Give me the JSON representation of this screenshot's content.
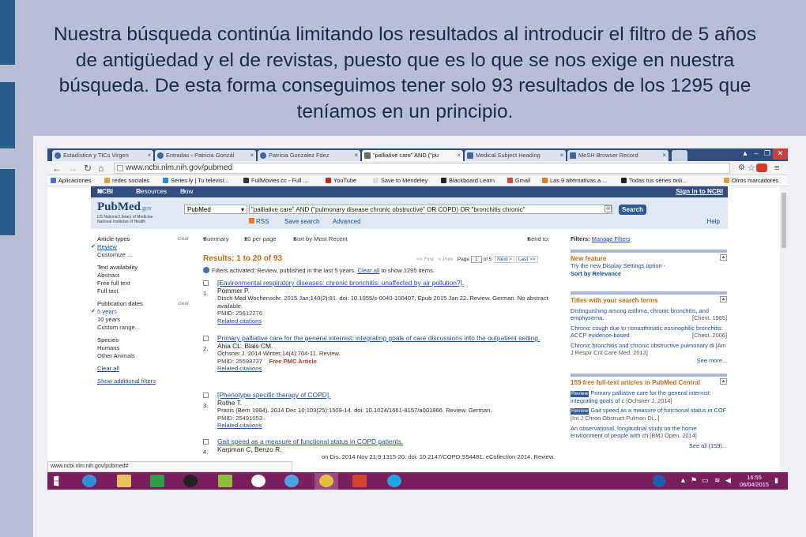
{
  "slide": {
    "caption": "Nuestra búsqueda continúa limitando los resultados al introducir el filtro de 5 años de antigüedad y el de revistas, puesto que es lo que se nos exige en nuestra búsqueda. De esta forma conseguimos tener solo 93 resultados de los 1295 que teníamos en un principio."
  },
  "browser": {
    "tabs": [
      {
        "label": "Estadística y TICs Virgen"
      },
      {
        "label": "Entradas ‹ Patricia Gonzál"
      },
      {
        "label": "Patricia Gonzalez Fdez"
      },
      {
        "label": "\"palliative care\" AND (\"pu"
      },
      {
        "label": "Medical Subject Heading"
      },
      {
        "label": "MeSH Browser Record"
      }
    ],
    "url": "www.ncbi.nlm.nih.gov/pubmed",
    "bookmarks": [
      {
        "label": "Aplicaciones"
      },
      {
        "label": "redes sociales"
      },
      {
        "label": "Series.ly | Tu televisi..."
      },
      {
        "label": "FullMovies.cc - Full ..."
      },
      {
        "label": "YouTube"
      },
      {
        "label": "Save to Mendeley"
      },
      {
        "label": "Blackboard Learn"
      },
      {
        "label": "Gmail"
      },
      {
        "label": "Las 9 alternativas a ..."
      },
      {
        "label": "Todas tus series onli..."
      },
      {
        "label": "Otros marcadores"
      }
    ],
    "status_url": "www.ncbi.nlm.nih.gov/pubmed#"
  },
  "ncbi": {
    "brand": "NCBI",
    "resources": "Resources",
    "howto": "How To",
    "signin": "Sign in to NCBI"
  },
  "pubmed": {
    "logo": "PubMed",
    "logo_suffix": ".gov",
    "logo_sub1": "US National Library of Medicine",
    "logo_sub2": "National Institutes of Health",
    "db": "PubMed",
    "query": "\"palliative care\" AND (\"pulmonary disease chronic obstructive\" OR COPD) OR \"bronchitis chronic\"",
    "search_btn": "Search",
    "rss": "RSS",
    "save_search": "Save search",
    "advanced": "Advanced",
    "help": "Help"
  },
  "sidebar": {
    "clear": "clear",
    "article_types": "Article types",
    "review": "Review",
    "customize": "Customize ...",
    "text_availability": "Text availability",
    "abstract": "Abstract",
    "free_full_text": "Free full text",
    "full_text": "Full text",
    "pub_dates": "Publication dates",
    "five_years": "5 years",
    "ten_years": "10 years",
    "custom_range": "Custom range...",
    "species": "Species",
    "humans": "Humans",
    "other_animals": "Other Animals",
    "clear_all": "Clear all",
    "show_additional": "Show additional filters"
  },
  "results": {
    "summary": "Summary",
    "per_page": "20 per page",
    "sort": "Sort by Most Recent",
    "send_to": "Send to:",
    "title": "Results: 1 to 20 of 93",
    "first": "<< First",
    "prev": "< Prev",
    "page_label": "Page",
    "page": "1",
    "of": "of 5",
    "next": "Next >",
    "last": "Last >>",
    "filters_text": "Filters activated: Review, published in the last 5 years.",
    "clear_all": "Clear all",
    "filters_tail": "to show 1295 items.",
    "items": [
      {
        "num": "1.",
        "title": "[Environmental respiratory diseases: chronic bronchitis: unaffected by air pollution?].",
        "authors": "Pommer P.",
        "citation": "Dtsch Med Wochenschr. 2015 Jan;140(2):81. doi: 10.1055/s-0040-100407. Epub 2015 Jan 22. Review. German. No abstract available.",
        "pmid": "PMID: 25612276",
        "pmc": "",
        "related": "Related citations"
      },
      {
        "num": "2.",
        "title": "Primary palliative care for the general internist: integrating goals of care discussions into the outpatient setting.",
        "authors": "Ahia CL, Blais CM.",
        "citation": "Ochsner J. 2014 Winter;14(4):704-11. Review.",
        "pmid": "PMID: 25598737",
        "pmc": "Free PMC Article",
        "related": "Related citations"
      },
      {
        "num": "3.",
        "title": "[Phenotype specific therapy of COPD].",
        "authors": "Rothe T.",
        "citation": "Praxis (Bern 1994). 2014 Dec 10;103(25):1509-14. doi: 10.1024/1661-8157/a001866. Review. German.",
        "pmid": "PMID: 25491053",
        "pmc": "",
        "related": "Related citations"
      },
      {
        "num": "4.",
        "title": "Gait speed as a measure of functional status in COPD patients.",
        "authors": "Karpman C, Benzo R.",
        "citation": "on Dis. 2014 Nov 21;9:1315-20. doi: 10.2147/COPD.S54481. eCollection 2014. Review.",
        "pmid": "",
        "pmc": "",
        "related": ""
      }
    ]
  },
  "right": {
    "filters_label": "Filters:",
    "manage": "Manage Filters",
    "new_feature": "New feature",
    "nf_text": "Try the new Display Settings option -",
    "nf_bold": "Sort by Relevance",
    "titles_header": "Titles with your search terms",
    "titles": [
      {
        "text": "Distinguishing among asthma, chronic bronchitis, and emphysema.",
        "src": "[Chest. 1985]"
      },
      {
        "text": "Chronic cough due to nonasthmatic eosinophilic bronchitis: ACCP evidence-based",
        "src": "[Chest. 2006]"
      },
      {
        "text": "Chronic bronchitis and chronic obstructive pulmonary di",
        "src": "[Am J Respir Crit Care Med. 2013]"
      }
    ],
    "see_more": "See more...",
    "free_header": "159 free full-text articles in PubMed Central",
    "free": [
      {
        "badge": "Review",
        "text": "Primary palliative care for the general internist: integrating goals of c",
        "src": "[Ochsner J. 2014]"
      },
      {
        "badge": "Review",
        "text": "Gait speed as a measure of functional status in COF",
        "src": "[Int J Chron Obstruct Pulmon Di...]"
      },
      {
        "badge": "",
        "text": "An observational, longitudinal study on the home environment of people with ch",
        "src": "[BMJ Open. 2014]"
      }
    ],
    "see_all": "See all (159)..."
  },
  "taskbar": {
    "time": "16:55",
    "date": "06/04/2015"
  },
  "colors": {
    "slide_bg": "#b8bed3",
    "accent_bar": "#2a5d8c",
    "taskbar": "#7a1f5e",
    "ncbi_bar": "#334d7f",
    "results_orange": "#c66d1a"
  }
}
